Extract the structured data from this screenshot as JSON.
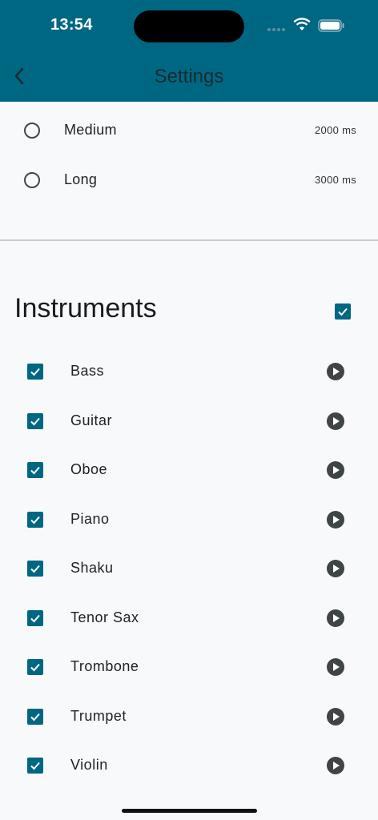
{
  "status_bar": {
    "time": "13:54"
  },
  "app_bar": {
    "title": "Settings",
    "back_icon": "chevron-left-icon"
  },
  "durations": [
    {
      "label": "Medium",
      "value": "2000 ms",
      "selected": false
    },
    {
      "label": "Long",
      "value": "3000 ms",
      "selected": false
    }
  ],
  "instruments": {
    "title": "Instruments",
    "all_checked": true,
    "items": [
      {
        "label": "Bass",
        "checked": true
      },
      {
        "label": "Guitar",
        "checked": true
      },
      {
        "label": "Oboe",
        "checked": true
      },
      {
        "label": "Piano",
        "checked": true
      },
      {
        "label": "Shaku",
        "checked": true
      },
      {
        "label": "Tenor Sax",
        "checked": true
      },
      {
        "label": "Trombone",
        "checked": true
      },
      {
        "label": "Trumpet",
        "checked": true
      },
      {
        "label": "Violin",
        "checked": true
      }
    ]
  },
  "colors": {
    "primary": "#006782",
    "background": "#f8f9fb"
  }
}
